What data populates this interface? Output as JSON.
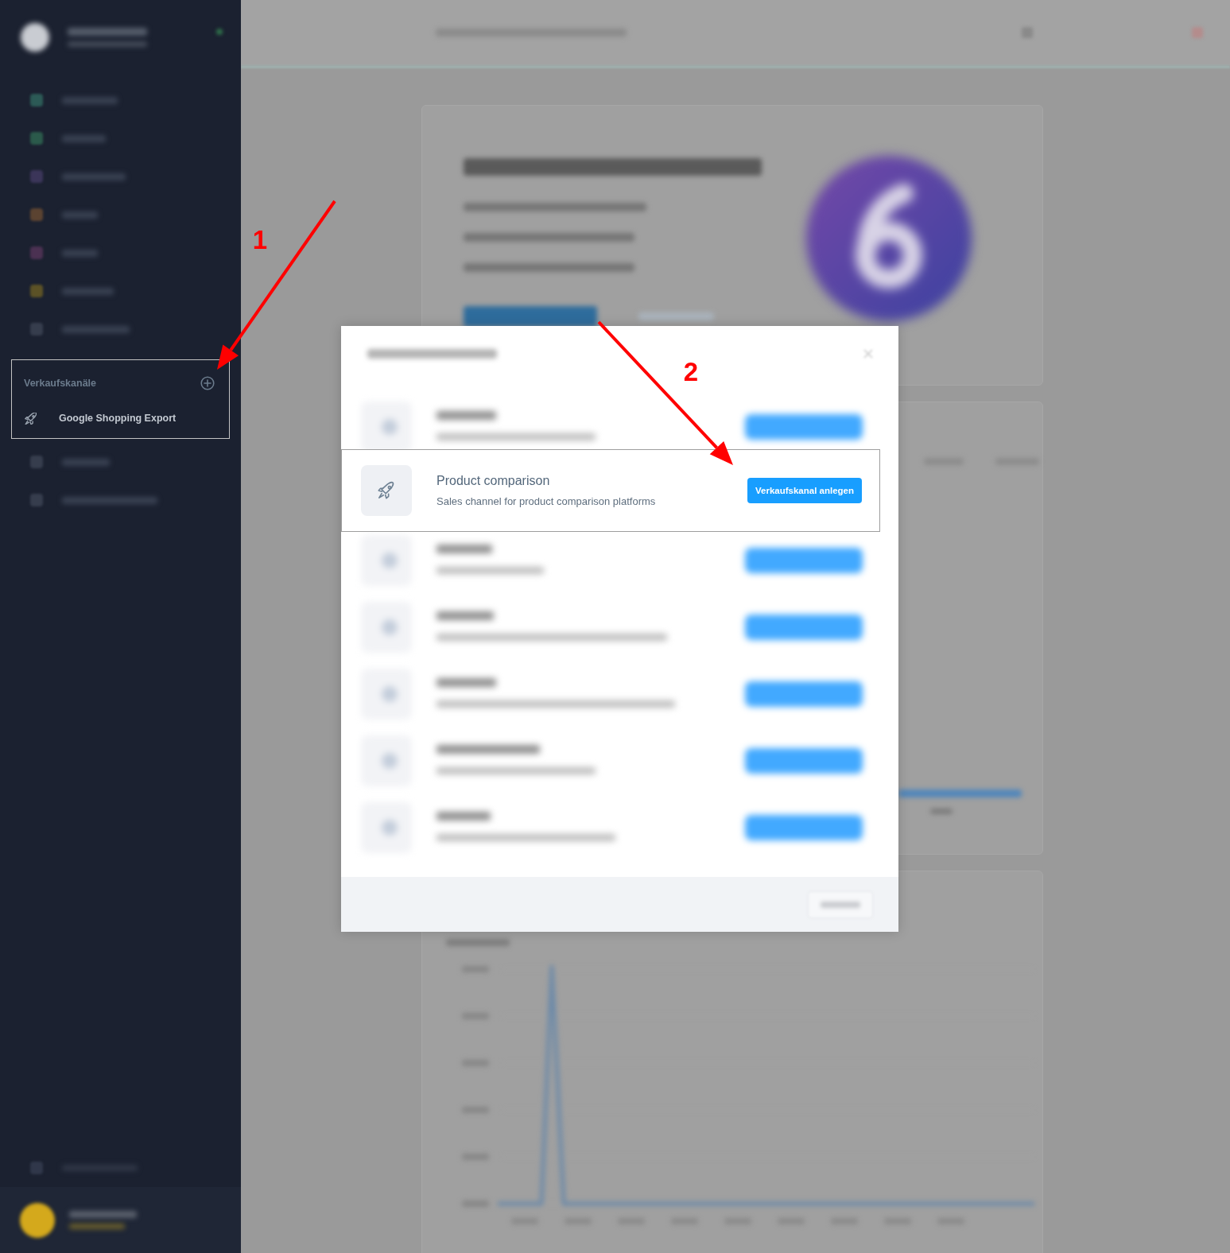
{
  "sidebar": {
    "menu_items": [
      {
        "color": "#2c5a56"
      },
      {
        "color": "#2b5a4b"
      },
      {
        "color": "#3b3559"
      },
      {
        "color": "#5b4331"
      },
      {
        "color": "#4b3152"
      },
      {
        "color": "#5c5226"
      },
      {
        "color": "#363d4d"
      }
    ],
    "sales_channels": {
      "title": "Verkaufskanäle",
      "channels": [
        {
          "label": "Google Shopping Export"
        }
      ]
    }
  },
  "modal": {
    "rows": [
      {
        "highlighted": false
      },
      {
        "highlighted": true,
        "title": "Product comparison",
        "description": "Sales channel for product comparison platforms",
        "button": "Verkaufskanal anlegen"
      },
      {
        "highlighted": false
      },
      {
        "highlighted": false
      },
      {
        "highlighted": false
      },
      {
        "highlighted": false
      },
      {
        "highlighted": false
      }
    ]
  },
  "annotations": [
    {
      "label": "1"
    },
    {
      "label": "2"
    }
  ]
}
